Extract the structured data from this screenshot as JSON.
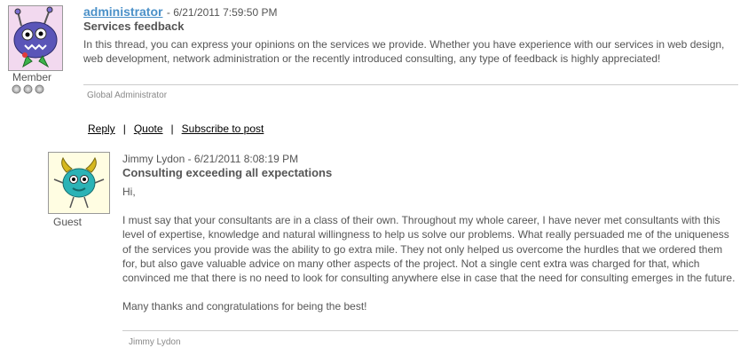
{
  "post1": {
    "author": "administrator",
    "timestamp": "- 6/21/2011 7:59:50 PM",
    "subject": "Services feedback",
    "body": "In this thread, you can express your opinions on the services we provide. Whether you have experience with our services in web design, web development, network administration or the recently introduced consulting, any type of feedback is highly appreciated!",
    "role": "Member",
    "signature": "Global Administrator",
    "avatar_icon": "purple-monster-avatar",
    "medal_icon": "silver-medal-icon",
    "actions": {
      "reply": "Reply",
      "quote": "Quote",
      "subscribe": "Subscribe to post",
      "separator": "|"
    }
  },
  "post2": {
    "author": "Jimmy Lydon",
    "timestamp": "- 6/21/2011 8:08:19 PM",
    "subject": "Consulting exceeding all expectations",
    "greeting": "Hi,",
    "body": "I must say that your consultants are in a class of their own. Throughout my whole career, I have never met consultants with this level of expertise, knowledge and natural willingness to help us solve our problems. What really persuaded me of the uniqueness of the services you provide was the ability to go extra mile. They not only helped us overcome the hurdles that we ordered them for, but also gave valuable advice on many other aspects of the project. Not a single cent extra was charged for that, which convinced me that there is no need to look for consulting anywhere else in case that the need for consulting emerges in the future.",
    "closing": "Many thanks and congratulations for being the best!",
    "role": "Guest",
    "signature": "Jimmy Lydon",
    "avatar_icon": "teal-monster-avatar"
  },
  "colors": {
    "link": "#4a90c8",
    "text": "#555555",
    "divider": "#cccccc",
    "avatar_bg": "#f2d9ef"
  }
}
